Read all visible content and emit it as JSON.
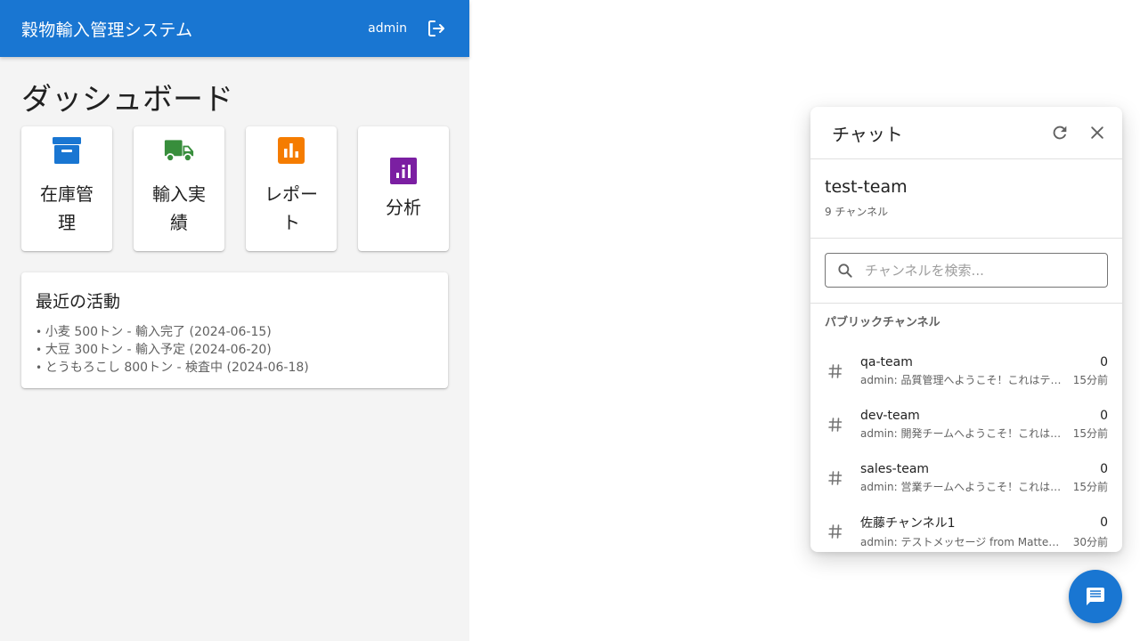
{
  "app": {
    "title": "穀物輸入管理システム",
    "user": "admin",
    "page_title": "ダッシュボード",
    "cards": [
      {
        "label": "在庫管理",
        "icon": "archive-icon",
        "color": "#1976d2"
      },
      {
        "label": "輸入実績",
        "icon": "truck-icon",
        "color": "#388e3c"
      },
      {
        "label": "レポート",
        "icon": "bar-chart-icon",
        "color": "#f57c00"
      },
      {
        "label": "分析",
        "icon": "analytics-icon",
        "color": "#7b1fa2"
      }
    ],
    "activity": {
      "title": "最近の活動",
      "items": [
        "小麦 500トン - 輸入完了 (2024-06-15)",
        "大豆 300トン - 輸入予定 (2024-06-20)",
        "とうもろこし 800トン - 検査中 (2024-06-18)"
      ]
    }
  },
  "chat": {
    "title": "チャット",
    "team_name": "test-team",
    "channel_count": "9 チャンネル",
    "search_placeholder": "チャンネルを検索...",
    "section": "パブリックチャンネル",
    "channels": [
      {
        "name": "qa-team",
        "count": "0",
        "message": "admin: 品質管理へようこそ！これはテストメッセージです",
        "time": "15分前"
      },
      {
        "name": "dev-team",
        "count": "0",
        "message": "admin: 開発チームへようこそ！これはテストメッセージです",
        "time": "15分前"
      },
      {
        "name": "sales-team",
        "count": "0",
        "message": "admin: 営業チームへようこそ！これはテストメッセージです",
        "time": "15分前"
      },
      {
        "name": "佐藤チャンネル1",
        "count": "0",
        "message": "admin: テストメッセージ from Mattermost",
        "time": "30分前"
      }
    ]
  },
  "colors": {
    "primary": "#1976d2",
    "background": "#f4f4f4"
  }
}
